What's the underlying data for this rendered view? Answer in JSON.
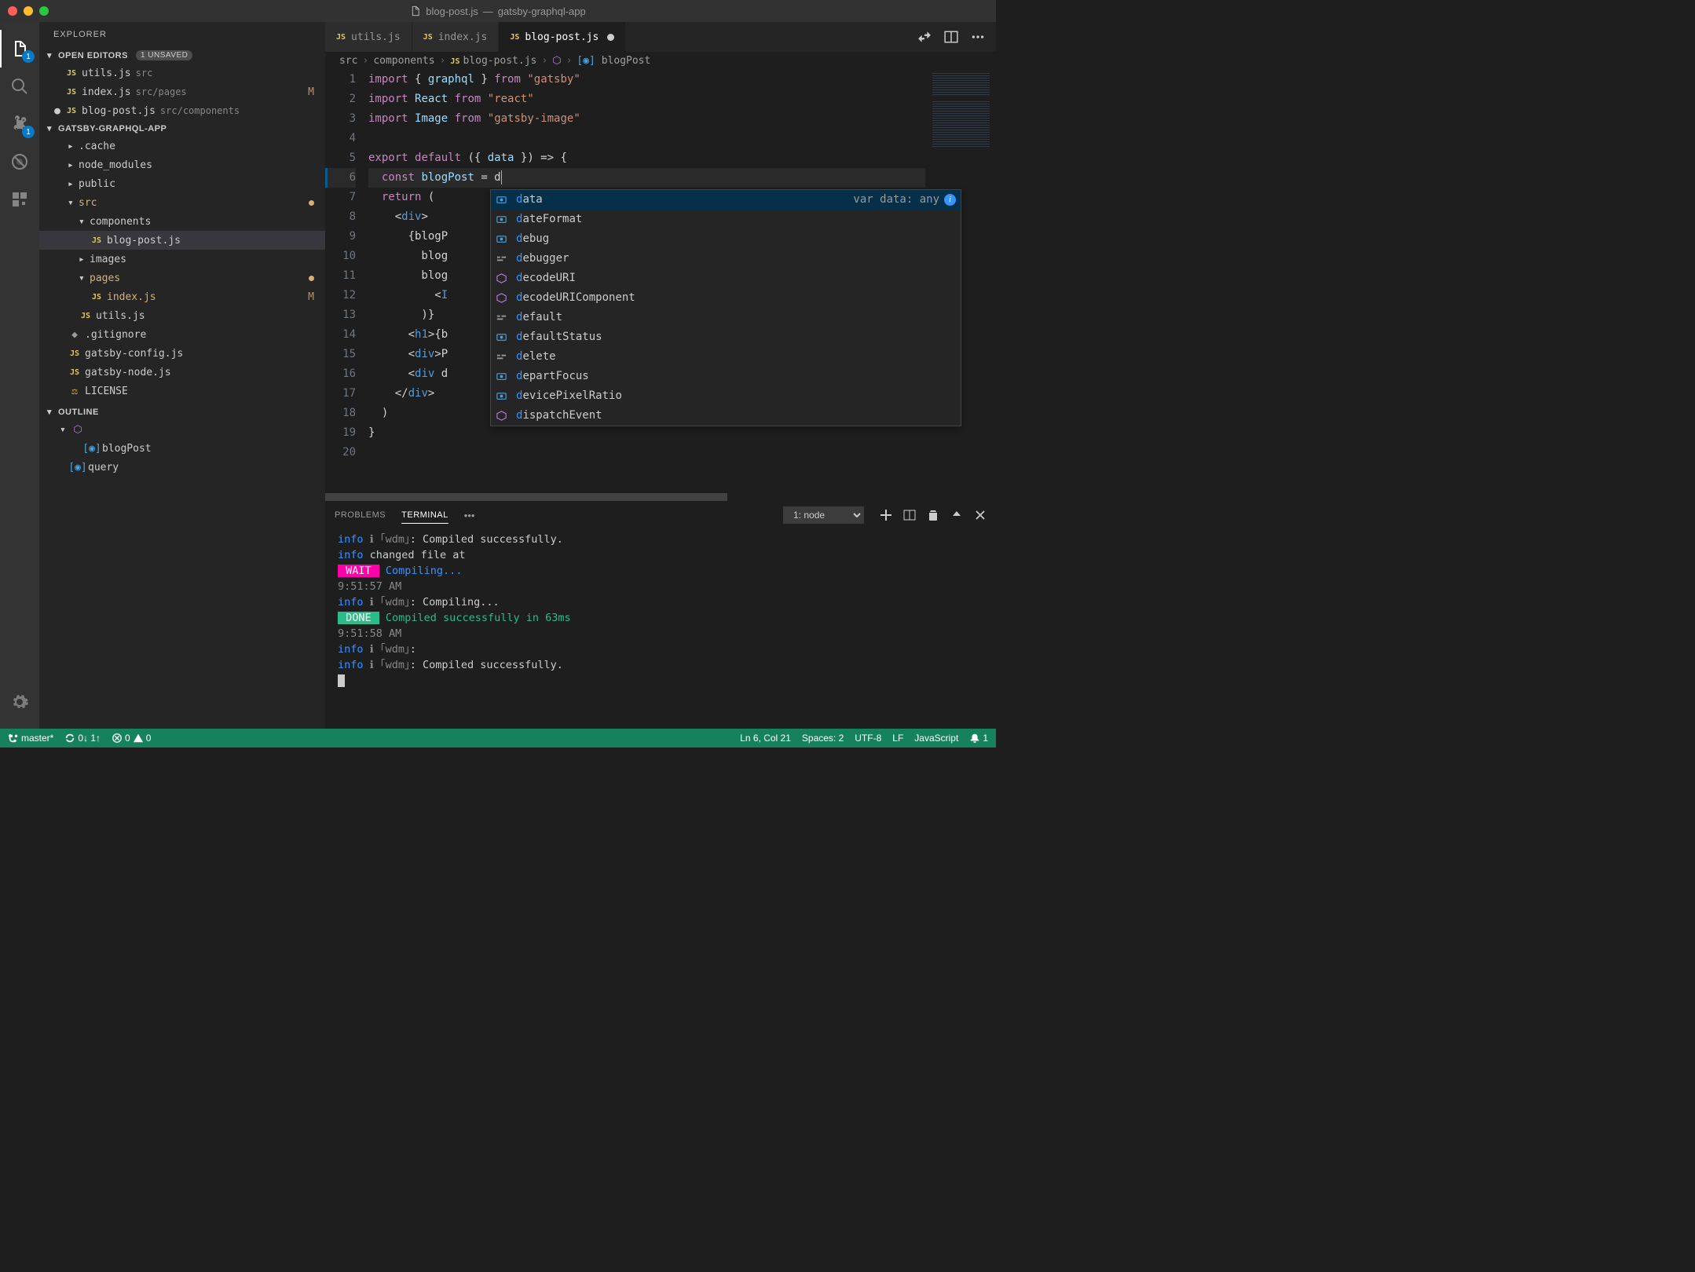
{
  "title": {
    "file": "blog-post.js",
    "project": "gatsby-graphql-app"
  },
  "activityBar": {
    "explorerBadge": "1",
    "scmBadge": "1"
  },
  "sidebar": {
    "title": "EXPLORER",
    "sections": {
      "openEditors": {
        "label": "OPEN EDITORS",
        "badge": "1 UNSAVED"
      },
      "project": {
        "label": "GATSBY-GRAPHQL-APP"
      },
      "outline": {
        "label": "OUTLINE"
      }
    },
    "openEditors": [
      {
        "name": "utils.js",
        "path": "src",
        "status": ""
      },
      {
        "name": "index.js",
        "path": "src/pages",
        "status": "M"
      },
      {
        "name": "blog-post.js",
        "path": "src/components",
        "status": "●"
      }
    ],
    "tree": [
      {
        "name": ".cache",
        "type": "folder",
        "indent": 1,
        "expanded": false
      },
      {
        "name": "node_modules",
        "type": "folder",
        "indent": 1,
        "expanded": false
      },
      {
        "name": "public",
        "type": "folder",
        "indent": 1,
        "expanded": false
      },
      {
        "name": "src",
        "type": "folder",
        "indent": 1,
        "expanded": true,
        "mod": true,
        "dotTail": true
      },
      {
        "name": "components",
        "type": "folder",
        "indent": 2,
        "expanded": true
      },
      {
        "name": "blog-post.js",
        "type": "file",
        "indent": 3,
        "selected": true
      },
      {
        "name": "images",
        "type": "folder",
        "indent": 2,
        "expanded": false
      },
      {
        "name": "pages",
        "type": "folder",
        "indent": 2,
        "expanded": true,
        "mod": true,
        "dotTail": true
      },
      {
        "name": "index.js",
        "type": "file",
        "indent": 3,
        "status": "M",
        "mod": true
      },
      {
        "name": "utils.js",
        "type": "file",
        "indent": 2
      },
      {
        "name": ".gitignore",
        "type": "file",
        "indent": 1,
        "icon": "git"
      },
      {
        "name": "gatsby-config.js",
        "type": "file",
        "indent": 1
      },
      {
        "name": "gatsby-node.js",
        "type": "file",
        "indent": 1
      },
      {
        "name": "LICENSE",
        "type": "file",
        "indent": 1,
        "icon": "license"
      }
    ],
    "outline": [
      {
        "name": "<function>",
        "indent": 0,
        "icon": "cube",
        "expanded": true
      },
      {
        "name": "blogPost",
        "indent": 1,
        "icon": "var"
      },
      {
        "name": "query",
        "indent": 0,
        "icon": "var"
      }
    ]
  },
  "tabs": [
    {
      "label": "utils.js",
      "active": false
    },
    {
      "label": "index.js",
      "active": false
    },
    {
      "label": "blog-post.js",
      "active": true,
      "dirty": true
    }
  ],
  "breadcrumb": [
    "src",
    "components",
    "blog-post.js",
    "<function>",
    "blogPost"
  ],
  "code": {
    "lines": [
      "import { graphql } from \"gatsby\"",
      "import React from \"react\"",
      "import Image from \"gatsby-image\"",
      "",
      "export default ({ data }) => {",
      "  const blogPost = d",
      "  return (",
      "    <div>",
      "      {blogP",
      "        blog",
      "        blog",
      "          <I",
      "        )}",
      "      <h1>{b",
      "      <div>P",
      "      <div d",
      "    </div>",
      "  )",
      "}",
      ""
    ],
    "firstLine": 1,
    "highlightLine": 6
  },
  "suggest": {
    "items": [
      {
        "label": "data",
        "icon": "var",
        "selected": true,
        "detail": "var data: any"
      },
      {
        "label": "dateFormat",
        "icon": "var"
      },
      {
        "label": "debug",
        "icon": "var"
      },
      {
        "label": "debugger",
        "icon": "kw"
      },
      {
        "label": "decodeURI",
        "icon": "fn"
      },
      {
        "label": "decodeURIComponent",
        "icon": "fn"
      },
      {
        "label": "default",
        "icon": "kw"
      },
      {
        "label": "defaultStatus",
        "icon": "var"
      },
      {
        "label": "delete",
        "icon": "kw"
      },
      {
        "label": "departFocus",
        "icon": "var"
      },
      {
        "label": "devicePixelRatio",
        "icon": "var"
      },
      {
        "label": "dispatchEvent",
        "icon": "fn"
      }
    ]
  },
  "panel": {
    "tabs": [
      "PROBLEMS",
      "TERMINAL"
    ],
    "active": "TERMINAL",
    "dropdown": "1: node",
    "terminalLines": [
      {
        "parts": [
          {
            "t": "info",
            "c": "info"
          },
          {
            "t": " ℹ ",
            "c": "dim"
          },
          {
            "t": "｢wdm｣",
            "c": "dim"
          },
          {
            "t": ": Compiled successfully."
          }
        ]
      },
      {
        "parts": [
          {
            "t": "info",
            "c": "info"
          },
          {
            "t": " changed file at"
          }
        ]
      },
      {
        "parts": [
          {
            "t": " WAIT ",
            "c": "wait"
          },
          {
            "t": " Compiling...",
            "c": "info"
          }
        ]
      },
      {
        "parts": [
          {
            "t": "9:51:57 AM",
            "c": "dim"
          }
        ]
      },
      {
        "parts": [
          {
            "t": ""
          }
        ]
      },
      {
        "parts": [
          {
            "t": "info",
            "c": "info"
          },
          {
            "t": " ℹ ",
            "c": "dim"
          },
          {
            "t": "｢wdm｣",
            "c": "dim"
          },
          {
            "t": ": Compiling..."
          }
        ]
      },
      {
        "parts": [
          {
            "t": " DONE ",
            "c": "done"
          },
          {
            "t": " Compiled successfully in 63ms",
            "c": "done2"
          }
        ]
      },
      {
        "parts": [
          {
            "t": "9:51:58 AM",
            "c": "dim"
          }
        ]
      },
      {
        "parts": [
          {
            "t": ""
          }
        ]
      },
      {
        "parts": [
          {
            "t": "info",
            "c": "info"
          },
          {
            "t": " ℹ ",
            "c": "dim"
          },
          {
            "t": "｢wdm｣",
            "c": "dim"
          },
          {
            "t": ":"
          }
        ]
      },
      {
        "parts": [
          {
            "t": "info",
            "c": "info"
          },
          {
            "t": " ℹ ",
            "c": "dim"
          },
          {
            "t": "｢wdm｣",
            "c": "dim"
          },
          {
            "t": ": Compiled successfully."
          }
        ]
      }
    ]
  },
  "status": {
    "branch": "master*",
    "sync": "0↓ 1↑",
    "errors": "0",
    "warnings": "0",
    "cursor": "Ln 6, Col 21",
    "spaces": "Spaces: 2",
    "encoding": "UTF-8",
    "eol": "LF",
    "lang": "JavaScript",
    "notify": "1"
  }
}
